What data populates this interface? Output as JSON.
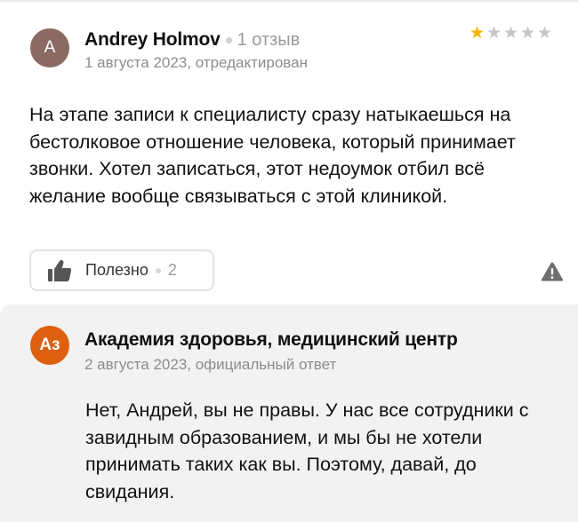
{
  "review": {
    "avatar_letter": "A",
    "author_name": "Andrey Holmov",
    "review_count": "1 отзыв",
    "date": "1 августа 2023, отредактирован",
    "rating": 1,
    "rating_max": 5,
    "text": "На этапе записи к специалисту сразу натыкаешься на бестолковое отношение человека, который принимает звонки. Хотел записаться, этот недоумок отбил всё желание вообще связываться с этой клиникой.",
    "helpful_label": "Полезно",
    "helpful_count": "2",
    "icons": {
      "helpful": "thumbs-up-icon",
      "report": "warning-icon",
      "star": "star-icon"
    },
    "colors": {
      "avatar": "#8a6a63",
      "star_filled": "#f5b300",
      "star_empty": "#c6c6c6"
    }
  },
  "reply": {
    "avatar_letter": "Аз",
    "org_name": "Академия здоровья, медицинский центр",
    "date": "2 августа 2023, официальный ответ",
    "text": "Нет, Андрей, вы не правы. У нас все сотрудники с завидным образованием, и мы бы не хотели принимать таких как вы. Поэтому, давай, до свидания.",
    "colors": {
      "avatar": "#dd5f0f",
      "background": "#f2f2f2"
    }
  }
}
